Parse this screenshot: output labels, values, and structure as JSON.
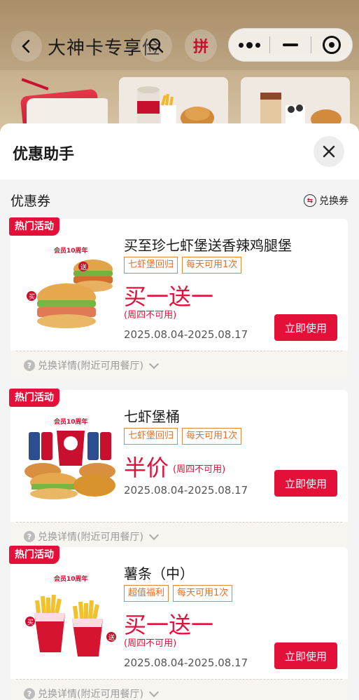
{
  "header": {
    "title": "大神卡专享俭",
    "pin_label": "拼"
  },
  "sheet": {
    "title": "优惠助手",
    "section_title": "优惠券",
    "exchange_label": "兑换券"
  },
  "coupons": [
    {
      "tag": "热门活动",
      "name": "买至珍七虾堡送香辣鸡腿堡",
      "labels": [
        "七虾堡回归",
        "每天可用1次"
      ],
      "promo": "买一送一",
      "note": "(周四不可用)",
      "date": "2025.08.04-2025.08.17",
      "button": "立即使用",
      "footer": "兑换详情(附近可用餐厅)",
      "anniv": "会员10周年"
    },
    {
      "tag": "热门活动",
      "name": "七虾堡桶",
      "labels": [
        "七虾堡回归",
        "每天可用1次"
      ],
      "promo": "半价",
      "note": "(周四不可用)",
      "date": "2025.08.04-2025.08.17",
      "button": "立即使用",
      "footer": "兑换详情(附近可用餐厅)",
      "anniv": "会员10周年"
    },
    {
      "tag": "热门活动",
      "name": "薯条（中）",
      "labels": [
        "超值福利",
        "每天可用1次"
      ],
      "promo": "买一送一",
      "note": "(周四不可用)",
      "date": "2025.08.04-2025.08.17",
      "button": "立即使用",
      "footer": "兑换详情(附近可用餐厅)",
      "anniv": "会员10周年"
    }
  ],
  "badges": {
    "buy": "买",
    "gift": "送"
  },
  "colors": {
    "accent": "#e3103a",
    "tag_border": "#e08a37"
  }
}
